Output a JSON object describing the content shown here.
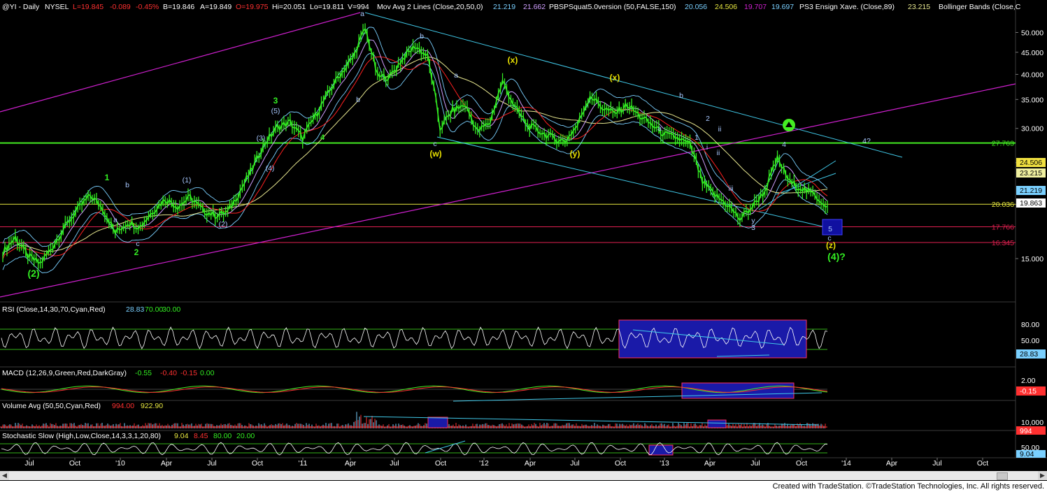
{
  "header": {
    "symbol": "@YI - Daily",
    "exchange": "NYSEL",
    "last": "L=19.845",
    "change": "-0.089",
    "change_pct": "-0.45%",
    "bid": "B=19.846",
    "ask": "A=19.849",
    "open": "O=19.975",
    "high": "Hi=20.051",
    "low": "Lo=19.811",
    "volume": "V=994",
    "ma_label": "Mov Avg 2 Lines (Close,20,50,0)",
    "ma_v1": "21.219",
    "ma_v2": "21.662",
    "pbs_label": "PBSPSquat5.0version (50,FALSE,150)",
    "pbs_v1": "20.056",
    "pbs_v2": "24.506",
    "pbs_v3": "19.707",
    "pbs_v4": "19.697",
    "ps3_label": "PS3 Ensign Xave. (Close,89)",
    "ps3_v": "23.215",
    "bb_label": "Bollinger Bands (Close,C"
  },
  "colors": {
    "background": "#000000",
    "price_green": "#33ee22",
    "price_up": "#33ee22",
    "ma20": "#d0a0ff",
    "ma50": "#ff2020",
    "ensign": "#e8e890",
    "bb": "#7ad0ff",
    "magenta": "#d020d0",
    "cyan": "#40c8e8",
    "green_line": "#44ee22",
    "yellow_line": "#e8e840",
    "red_line": "#e02050",
    "label_blue": "#a8c8ff",
    "label_green": "#33ee22",
    "label_yellow": "#e8e000"
  },
  "chart_data": [
    {
      "type": "line",
      "title": "@YI - Daily",
      "x_ticks": [
        "Jul",
        "Oct",
        "'10",
        "Apr",
        "Jul",
        "Oct",
        "'11",
        "Apr",
        "Jul",
        "Oct",
        "'12",
        "Apr",
        "Jul",
        "Oct",
        "'13",
        "Apr",
        "Jul",
        "Oct",
        "'14",
        "Apr",
        "Jul",
        "Oct"
      ],
      "y_ticks": [
        "50.000",
        "45.000",
        "40.000",
        "35.000",
        "30.000",
        "25.000",
        "20.000",
        "15.000"
      ],
      "y_scale": "log",
      "ylim": [
        12.0,
        56.0
      ],
      "series": [
        {
          "values": [
            15.5,
            16.8,
            15.2,
            14.6,
            16.0,
            17.8,
            19.5,
            21.0,
            19.6,
            17.2,
            18.2,
            17.8,
            19.3,
            20.6,
            19.8,
            20.8,
            19.4,
            18.9,
            19.2,
            21.5,
            24.3,
            27.8,
            30.2,
            31.0,
            28.5,
            32.0,
            36.0,
            40.0,
            43.5,
            51.0,
            39.5,
            39.5,
            43.5,
            46.5,
            44.0,
            30.0,
            33.0,
            34.0,
            29.5,
            31.0,
            38.5,
            33.5,
            30.5,
            29.5,
            28.5,
            28.0,
            30.5,
            35.8,
            33.5,
            32.5,
            34.0,
            32.0,
            30.5,
            29.0,
            28.5,
            27.5,
            22.5,
            21.0,
            20.0,
            18.5,
            19.8,
            21.5,
            25.5,
            22.5,
            21.8,
            21.0,
            19.8
          ]
        },
        {
          "name": "20.036 (Close,20,50,0)",
          "values": [
            21.219
          ]
        },
        {
          "name": "19.863",
          "values": [
            19.863
          ]
        }
      ],
      "levels": [
        "27.763",
        "24.506",
        "23.215",
        "21.219",
        "20.036",
        "19.863",
        "17.766",
        "16.345"
      ],
      "wave_labels": {
        "green": [
          "(2)",
          "1",
          "2",
          "3",
          "4",
          "(4)?"
        ],
        "yellow": [
          "(w)",
          "(x)",
          "(y)",
          "(x)",
          "(z)"
        ],
        "blue": [
          "(1)",
          "(2)",
          "(3)",
          "(4)",
          "(5)",
          "a",
          "b",
          "c",
          "1",
          "ii",
          "iii",
          "y",
          "3",
          "4",
          "5",
          "c",
          "4?",
          "a",
          "b",
          "c",
          "b",
          "a",
          "b",
          "a",
          "2",
          "i",
          "ii"
        ]
      }
    },
    {
      "type": "line",
      "title": "RSI (Close,14,30,70,Cyan,Red)",
      "values_label": [
        "28.83",
        "70.00",
        "30.00"
      ],
      "y_ticks": [
        "80.00",
        "50.00"
      ],
      "last": "28.83",
      "ylim": [
        15,
        95
      ]
    },
    {
      "type": "line",
      "title": "MACD (12,26,9,Green,Red,DarkGray)",
      "values_label": [
        "-0.55",
        "-0.40",
        "-0.15",
        "0.00"
      ],
      "y_ticks": [
        "2.00"
      ],
      "last": "-0.15"
    },
    {
      "type": "bar",
      "title": "Volume Avg (50,50,Cyan,Red)",
      "values_label": [
        "994.00",
        "922.90"
      ],
      "y_ticks": [
        "10,000"
      ],
      "last": "994"
    },
    {
      "type": "line",
      "title": "Stochastic Slow (High,Low,Close,14,3,3,1,20,80)",
      "values_label": [
        "9.04",
        "8.45",
        "80.00",
        "20.00"
      ],
      "y_ticks": [
        "50.00"
      ],
      "last": "9.04"
    }
  ],
  "footer": {
    "credit": "Created with TradeStation. ©TradeStation Technologies, Inc. All rights reserved."
  }
}
